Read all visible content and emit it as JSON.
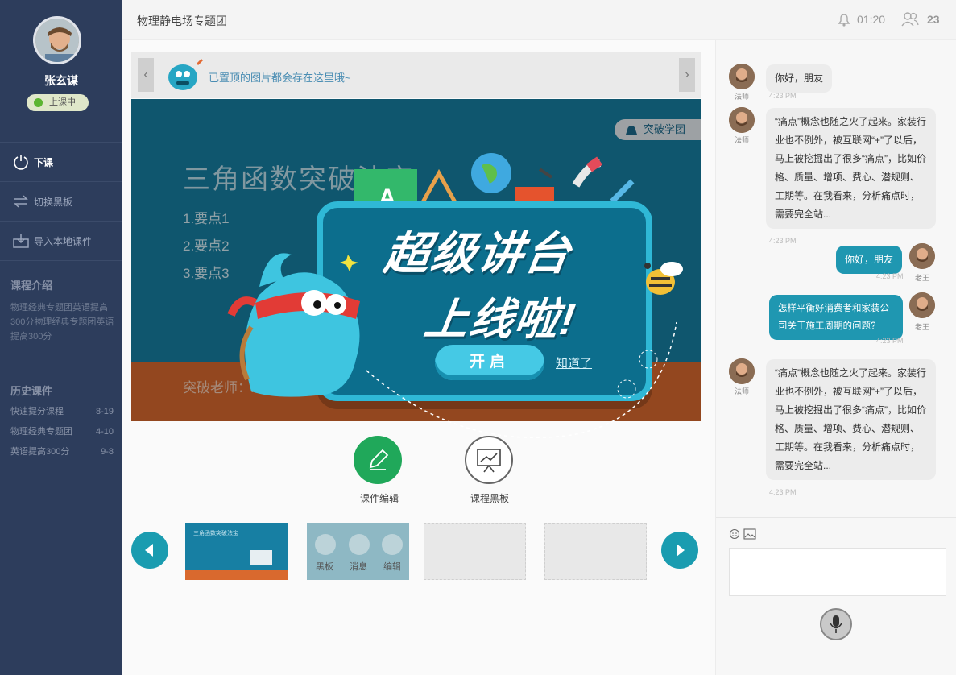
{
  "sidebar": {
    "user_name": "张玄谋",
    "status": "上课中",
    "menu": [
      {
        "label": "下课",
        "icon": "power-icon"
      },
      {
        "label": "切换黑板",
        "icon": "switch-icon"
      },
      {
        "label": "导入本地课件",
        "icon": "import-icon"
      }
    ],
    "intro_title": "课程介绍",
    "intro_text": "物理经典专题团英语提高300分物理经典专题团英语提高300分",
    "history_title": "历史课件",
    "history": [
      {
        "name": "快速提分课程",
        "date": "8-19"
      },
      {
        "name": "物理经典专题团",
        "date": "4-10"
      },
      {
        "name": "英语提高300分",
        "date": "9-8"
      }
    ]
  },
  "header": {
    "title": "物理静电场专题团",
    "timer": "01:20",
    "count": "23"
  },
  "pin_bar": {
    "text": "已置顶的图片都会存在这里哦~"
  },
  "slide": {
    "brand": "突破学团",
    "title": "三角函数突破法宝",
    "points": [
      "1.要点1",
      "2.要点2",
      "3.要点3"
    ],
    "footer": "突破老师：xxx，15年"
  },
  "popup": {
    "line1": "超级讲台",
    "line2": "上线啦!",
    "open_label": "开启",
    "know_label": "知道了"
  },
  "tools": {
    "edit_label": "课件编辑",
    "board_label": "课程黑板"
  },
  "thumbs": {
    "first_title": "三角函数突破法宝",
    "labels": [
      "黑板",
      "消息",
      "编辑"
    ]
  },
  "chat": {
    "messages": [
      {
        "who": "法师",
        "text": "你好，朋友",
        "time": "4:23 PM",
        "me": false
      },
      {
        "who": "法师",
        "text": "“痛点”概念也随之火了起来。家装行业也不例外，被互联网“+”了以后，马上被挖掘出了很多“痛点”，比如价格、质量、增项、费心、潜规则、工期等。在我看来，分析痛点时，需要完全站...",
        "time": "4:23 PM",
        "me": false
      },
      {
        "who": "老王",
        "text": "你好，朋友",
        "time": "4:23 PM",
        "me": true
      },
      {
        "who": "老王",
        "text": "怎样平衡好消费者和家装公司关于施工周期的问题?",
        "time": "4:23 PM",
        "me": true
      },
      {
        "who": "法师",
        "text": "“痛点”概念也随之火了起来。家装行业也不例外，被互联网“+”了以后，马上被挖掘出了很多“痛点”，比如价格、质量、增项、费心、潜规则、工期等。在我看来，分析痛点时，需要完全站...",
        "time": "4:23 PM",
        "me": false
      }
    ]
  },
  "colors": {
    "sidebar": "#2d3d5c",
    "accent": "#1f97b1",
    "slide_bg": "#177fa3",
    "slide_bottom": "#d9692e",
    "edit_button": "#20a85a"
  }
}
